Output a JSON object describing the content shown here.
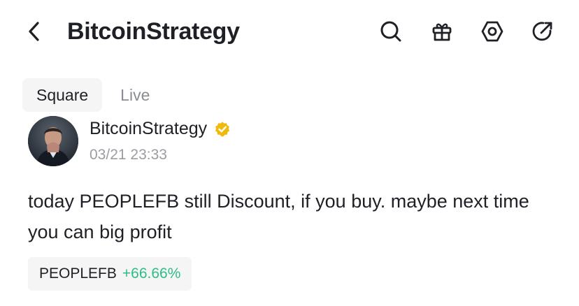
{
  "header": {
    "title": "BitcoinStrategy",
    "icons": [
      "back-icon",
      "search-icon",
      "gift-icon",
      "settings-icon",
      "share-icon"
    ]
  },
  "tabs": [
    {
      "label": "Square",
      "active": true
    },
    {
      "label": "Live",
      "active": false
    }
  ],
  "post": {
    "author": "BitcoinStrategy",
    "verified_icon": "verified-badge-icon",
    "timestamp": "03/21 23:33",
    "text": "today PEOPLEFB still Discount, if you buy. maybe next time you can big profit",
    "ticker": {
      "symbol": "PEOPLEFB",
      "change": "+66.66%"
    }
  },
  "colors": {
    "text": "#1e2026",
    "muted": "#9a9da3",
    "positive": "#2ebd85",
    "chip_bg": "#f5f5f5",
    "badge": "#f0b90b"
  }
}
